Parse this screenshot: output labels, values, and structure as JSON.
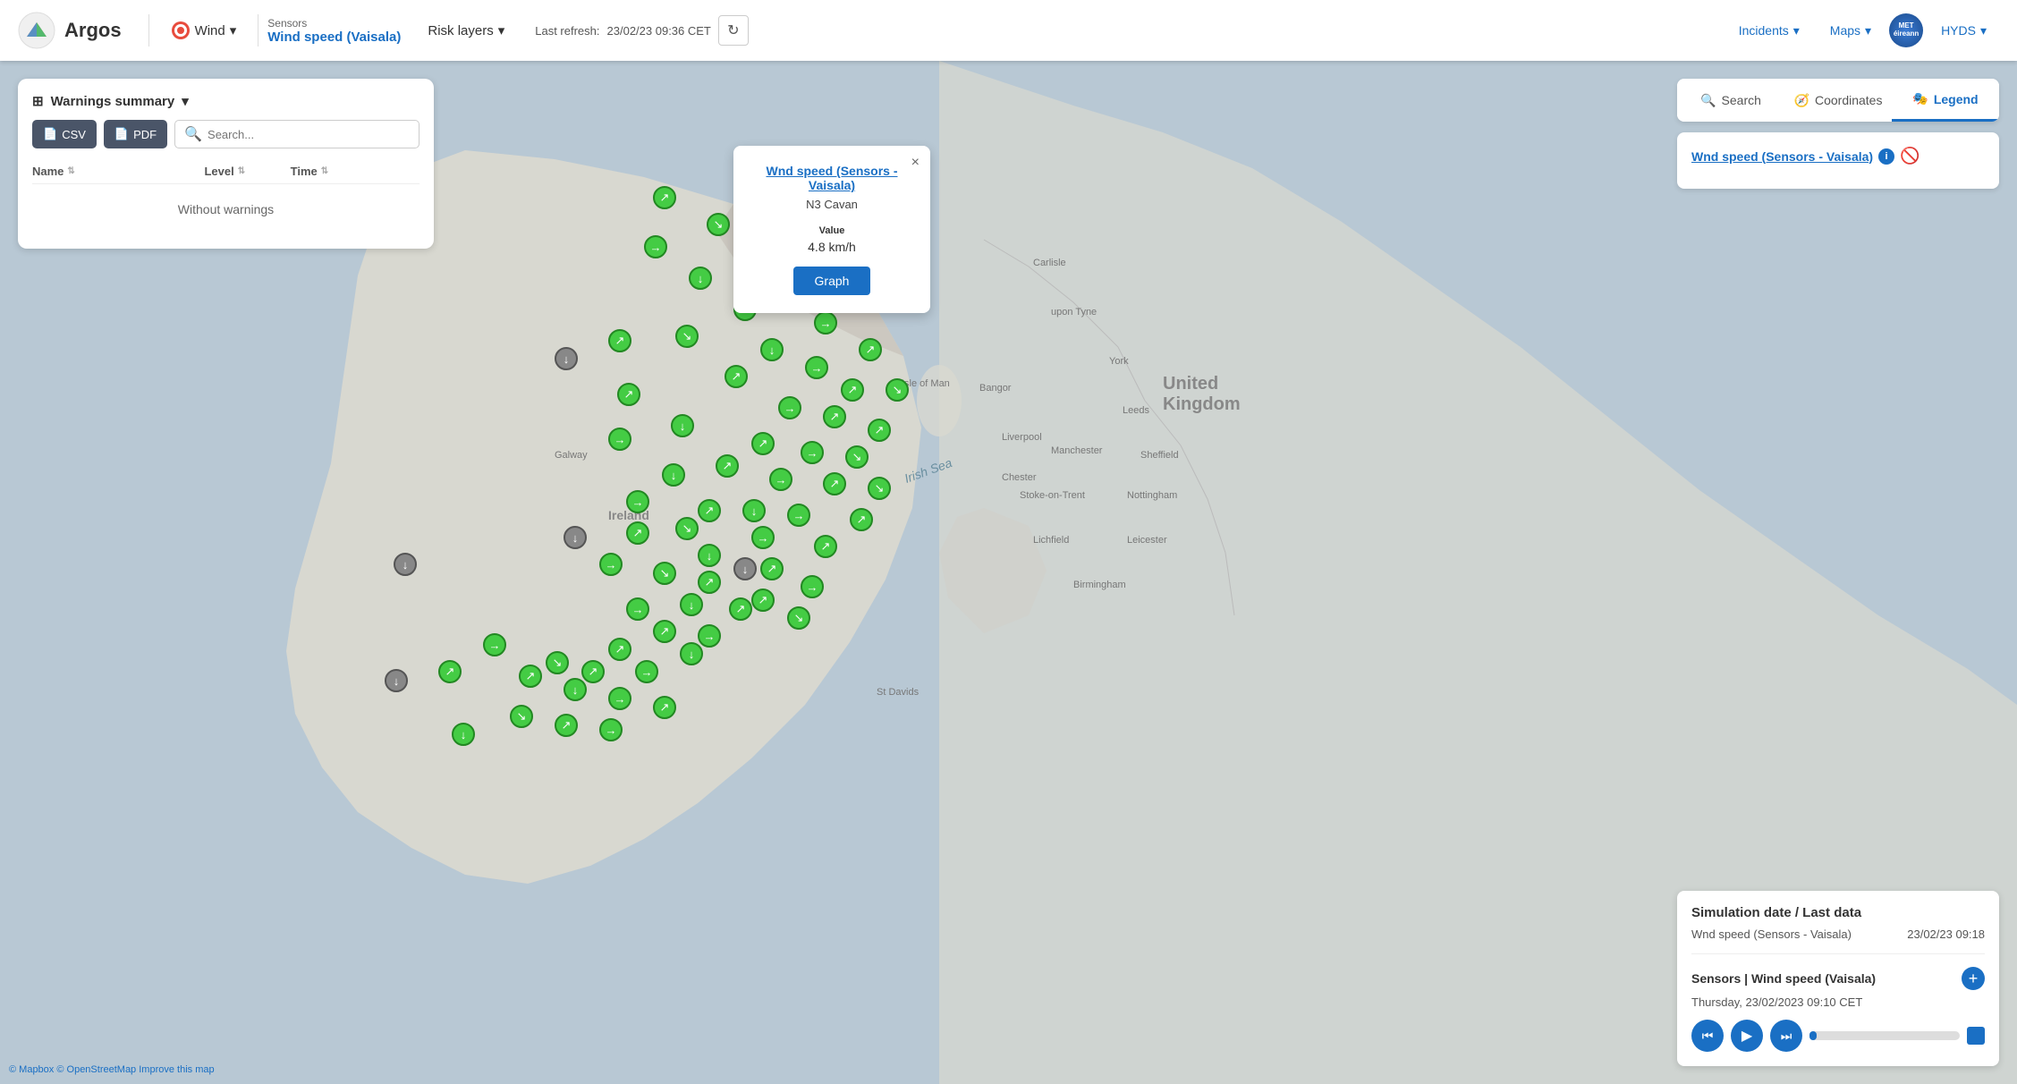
{
  "header": {
    "logo_text": "Argos",
    "wind_label": "Wind",
    "sensors_label": "Sensors",
    "sensors_value": "Wind speed (Vaisala)",
    "risk_layers_label": "Risk layers",
    "last_refresh_label": "Last refresh:",
    "last_refresh_time": "23/02/23 09:36 CET",
    "incidents_label": "Incidents",
    "maps_label": "Maps",
    "hyds_label": "HYDS"
  },
  "warnings_panel": {
    "title": "Warnings summary",
    "csv_btn": "CSV",
    "pdf_btn": "PDF",
    "search_placeholder": "Search...",
    "col_name": "Name",
    "col_level": "Level",
    "col_time": "Time",
    "no_warnings_text": "Without warnings"
  },
  "popup": {
    "title_line1": "Wnd speed (Sensors -",
    "title_line2": "Vaisala)",
    "subtitle": "N3 Cavan",
    "value_label": "Value",
    "value": "4.8 km/h",
    "graph_btn": "Graph"
  },
  "right_panel": {
    "search_tab": "Search",
    "coordinates_tab": "Coordinates",
    "legend_tab": "Legend",
    "legend_layer_name": "Wnd speed (Sensors - Vaisala)"
  },
  "bottom_panel": {
    "sim_date_title": "Simulation date / Last data",
    "layer_name": "Wnd speed (Sensors - Vaisala)",
    "layer_date": "23/02/23 09:18",
    "sensor_title": "Sensors | Wind speed (Vaisala)",
    "sensor_datetime": "Thursday, 23/02/2023 09:10 CET"
  },
  "map": {
    "ireland_label": "Ireland",
    "uk_label": "United Kingdom",
    "irish_sea_label": "Irish Sea",
    "isle_of_man_label": "Isle of Man",
    "cities": [
      "Carlisle",
      "Leeds",
      "York",
      "Sheffield",
      "Nottingham",
      "Leicester",
      "Birmingham",
      "Liverpool",
      "Manchester",
      "Chester",
      "Stoke-on-Trent",
      "Lichfield",
      "Bangor",
      "Galway",
      "St Davids"
    ],
    "attribution_mapbox": "© Mapbox",
    "attribution_osm": "© OpenStreetMap",
    "attribution_improve": "Improve this map"
  },
  "icons": {
    "search": "🔍",
    "coordinates": "🧭",
    "legend": "🎭",
    "refresh": "↻",
    "csv": "📄",
    "pdf": "📄",
    "info": "ℹ",
    "eye_slash": "👁",
    "plus": "+",
    "prev_prev": "⏮",
    "play": "▶",
    "next_next": "⏭",
    "sort": "⇅",
    "chevron_down": "▾",
    "grid": "⊞",
    "close": "×"
  },
  "colors": {
    "primary": "#1a6fc4",
    "header_bg": "#ffffff",
    "panel_bg": "#ffffff",
    "map_bg": "#b8c8d4",
    "green_dot": "#44cc44",
    "gray_dot": "#888888"
  }
}
